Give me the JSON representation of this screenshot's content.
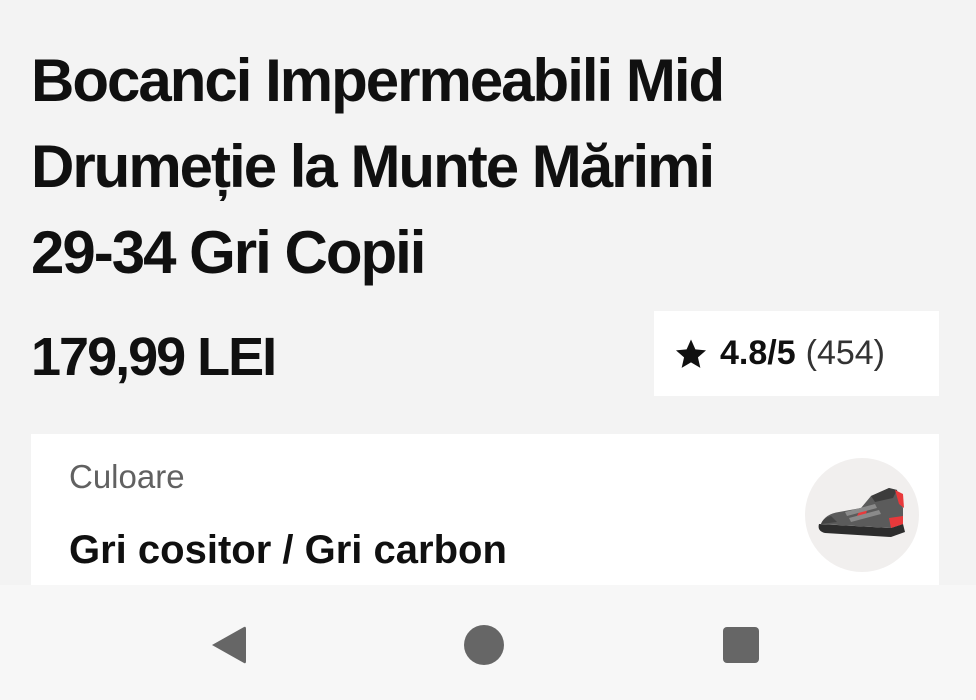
{
  "product": {
    "title_lines": [
      "Bocanci Impermeabili Mid",
      "Drumeție la Munte Mărimi",
      "29-34 Gri Copii"
    ],
    "price": "179,99 LEI"
  },
  "rating": {
    "icon": "star-icon",
    "score": "4.8/5",
    "count": "(454)"
  },
  "color_selector": {
    "label": "Culoare",
    "value": "Gri cositor / Gri carbon",
    "swatch_icon": "shoe-thumbnail",
    "colors": {
      "upper": "#5b5b5b",
      "accent": "#e8393b",
      "sole": "#2d2d2d"
    }
  },
  "nav_bar": {
    "back_icon": "back-triangle-icon",
    "home_icon": "home-circle-icon",
    "recents_icon": "recents-square-icon",
    "icon_color": "#666666"
  }
}
